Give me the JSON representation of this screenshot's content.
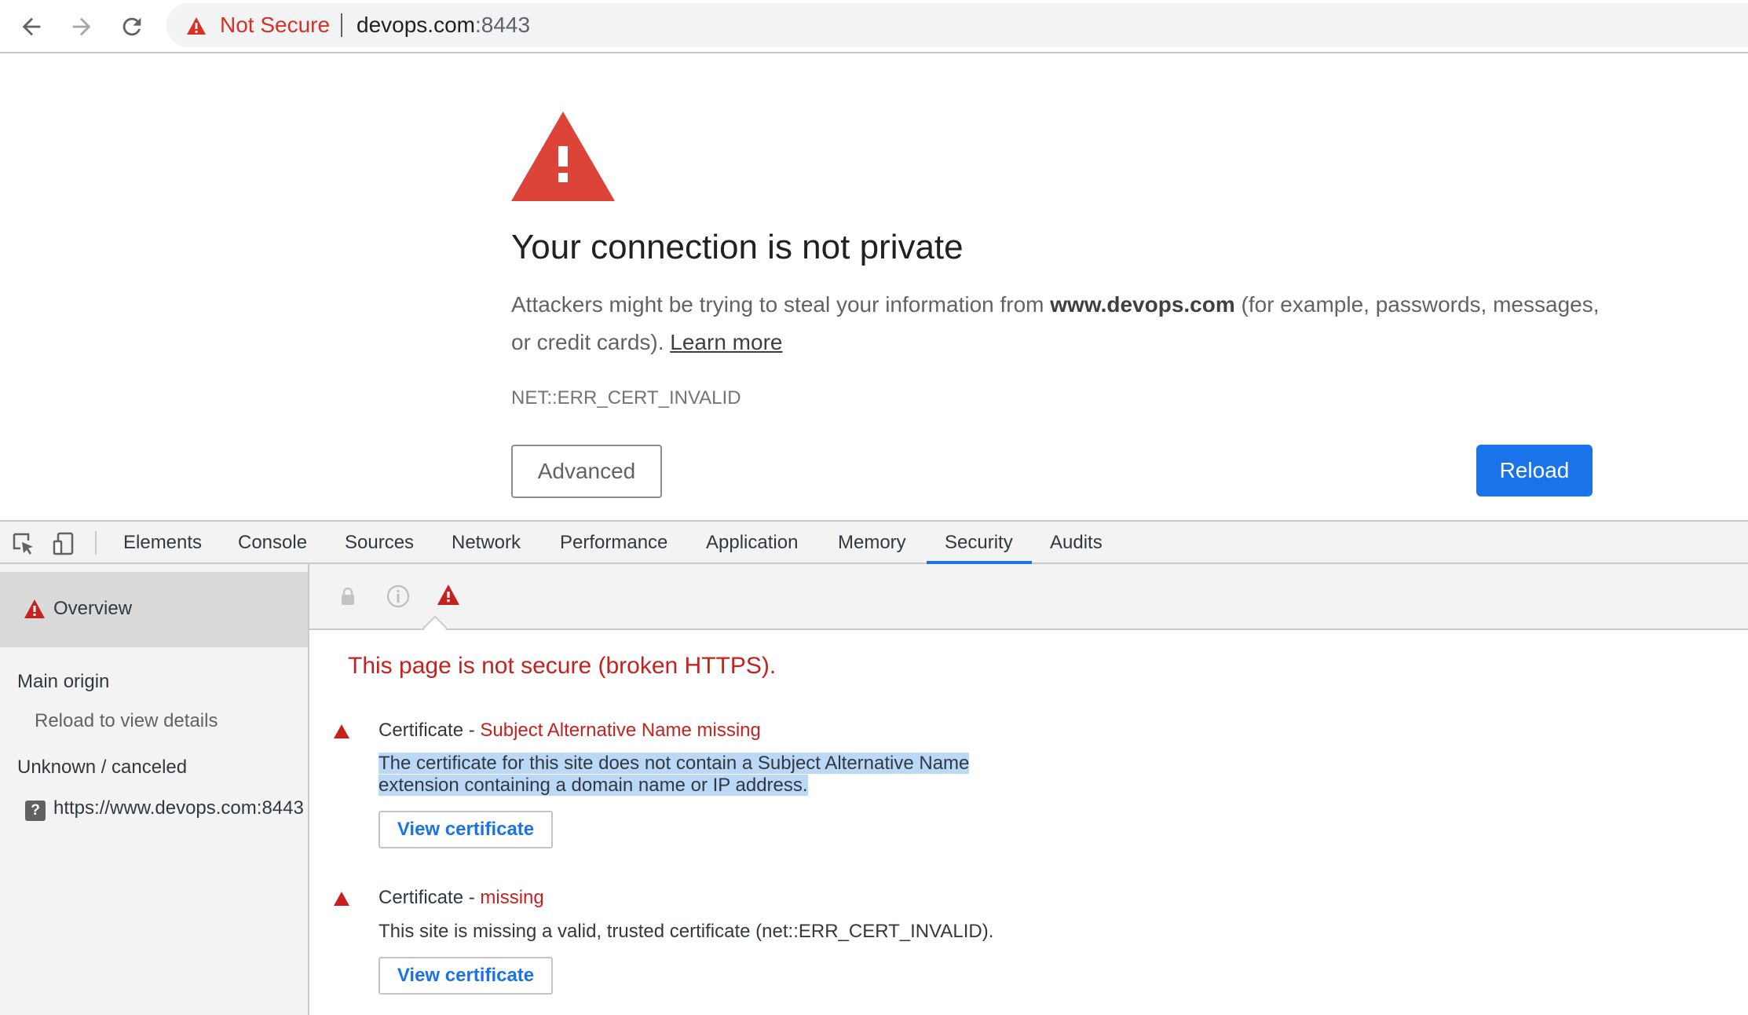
{
  "browser": {
    "security_label": "Not Secure",
    "url_host": "devops.com",
    "url_port": ":8443"
  },
  "interstitial": {
    "title": "Your connection is not private",
    "desc_before": "Attackers might be trying to steal your information from ",
    "desc_host": "www.devops.com",
    "desc_after": " (for example, passwords, messages, or credit cards). ",
    "learn_more": "Learn more",
    "error_code": "NET::ERR_CERT_INVALID",
    "advanced_label": "Advanced",
    "reload_label": "Reload",
    "colors": {
      "warning_red": "#d93025",
      "primary_blue": "#1a73e8"
    }
  },
  "devtools": {
    "tabs": [
      {
        "label": "Elements"
      },
      {
        "label": "Console"
      },
      {
        "label": "Sources"
      },
      {
        "label": "Network"
      },
      {
        "label": "Performance"
      },
      {
        "label": "Application"
      },
      {
        "label": "Memory"
      },
      {
        "label": "Security"
      },
      {
        "label": "Audits"
      }
    ],
    "active_tab": "Security",
    "sidebar": {
      "overview": "Overview",
      "main_origin": "Main origin",
      "main_origin_sub": "Reload to view details",
      "unknown": "Unknown / canceled",
      "unknown_icon": "?",
      "origin_url": "https://www.devops.com:8443"
    },
    "security": {
      "summary": "This page is not secure (broken HTTPS).",
      "issues": [
        {
          "title_prefix": "Certificate - ",
          "title_issue": "Subject Alternative Name missing",
          "desc_line1": "The certificate for this site does not contain a Subject Alternative Name",
          "desc_line2": "extension containing a domain name or IP address.",
          "button": "View certificate"
        },
        {
          "title_prefix": "Certificate - ",
          "title_issue": "missing",
          "desc_line1": "This site is missing a valid, trusted certificate (net::ERR_CERT_INVALID).",
          "button": "View certificate"
        }
      ]
    }
  }
}
